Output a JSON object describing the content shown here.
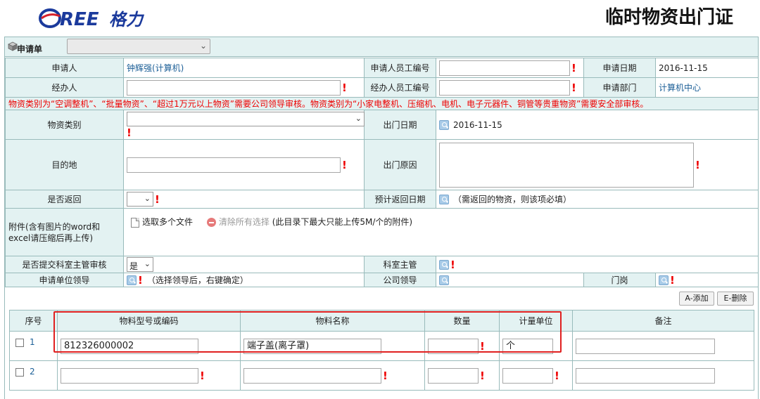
{
  "header": {
    "logo_text": "GREE格力",
    "title": "临时物资出门证"
  },
  "form": {
    "section_label": "申请单",
    "type_select_value": "",
    "applicant_label": "申请人",
    "applicant_value": "钟辉强(计算机)",
    "applicant_id_label": "申请人员工编号",
    "apply_date_label": "申请日期",
    "apply_date_value": "2016-11-15",
    "handler_label": "经办人",
    "handler_id_label": "经办人员工编号",
    "dept_label": "申请部门",
    "dept_value": "计算机中心",
    "warning": "物资类别为“空调整机”、“批量物资”、“超过1万元以上物资”需要公司领导审核。物资类别为“小家电整机、压缩机、电机、电子元器件、铜管等贵重物资”需要安全部审核。",
    "category_label": "物资类别",
    "out_date_label": "出门日期",
    "out_date_value": "2016-11-15",
    "destination_label": "目的地",
    "out_reason_label": "出门原因",
    "return_label": "是否返回",
    "return_date_label": "预计返回日期",
    "return_date_note": "（需返回的物资，则该项必填）",
    "attach_label": "附件(含有图片的word和excel请压缩后再上传)",
    "attach_select_label": "选取多个文件",
    "attach_clear_label": "清除所有选择",
    "attach_note": "(此目录下最大只能上传5M/个的附件)",
    "submit_review_label": "是否提交科室主管审核",
    "submit_review_value": "是",
    "section_head_label": "科室主管",
    "unit_leader_label": "申请单位领导",
    "unit_leader_note": "（选择领导后，右键确定）",
    "company_leader_label": "公司领导",
    "gate_label": "门岗",
    "required_mark": "!"
  },
  "toolbar": {
    "add_label": "A-添加",
    "delete_label": "E-删除"
  },
  "items": {
    "columns": [
      "序号",
      "物料型号或编码",
      "物料名称",
      "数量",
      "计量单位",
      "备注"
    ],
    "rows": [
      {
        "no": "1",
        "code": "812326000002",
        "name": "端子盖(离子罩)",
        "qty": "",
        "unit": "个",
        "remark": ""
      },
      {
        "no": "2",
        "code": "",
        "name": "",
        "qty": "",
        "unit": "",
        "remark": ""
      }
    ]
  }
}
